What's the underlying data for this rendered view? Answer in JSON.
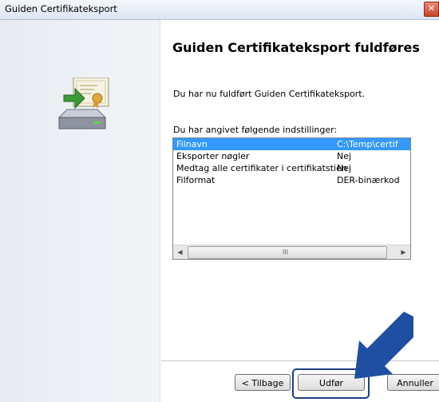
{
  "window": {
    "title": "Guiden Certifikateksport",
    "close_symbol": "✕"
  },
  "main": {
    "heading": "Guiden Certifikateksport fuldføres",
    "intro": "Du har nu fuldført Guiden Certifikateksport.",
    "settings_label": "Du har angivet følgende indstillinger:"
  },
  "settings_list": {
    "rows": [
      {
        "name": "Filnavn",
        "value": "C:\\Temp\\certif",
        "selected": true
      },
      {
        "name": "Eksporter nøgler",
        "value": "Nej",
        "selected": false
      },
      {
        "name": "Medtag alle certifikater i certifikatstien",
        "value": "Nej",
        "selected": false
      },
      {
        "name": "Filformat",
        "value": "DER-binærkod",
        "selected": false
      }
    ],
    "scroll_left": "◀",
    "scroll_right": "▶",
    "grip": "III"
  },
  "buttons": {
    "back": "< Tilbage",
    "finish": "Udfør",
    "cancel": "Annuller"
  },
  "icons": {
    "wizard": "certificate-export-icon",
    "callout": "callout-arrow-icon"
  },
  "colors": {
    "selection": "#3399ff",
    "callout_arrow": "#1f4fa3",
    "focus_ring": "#1c3f8a"
  }
}
